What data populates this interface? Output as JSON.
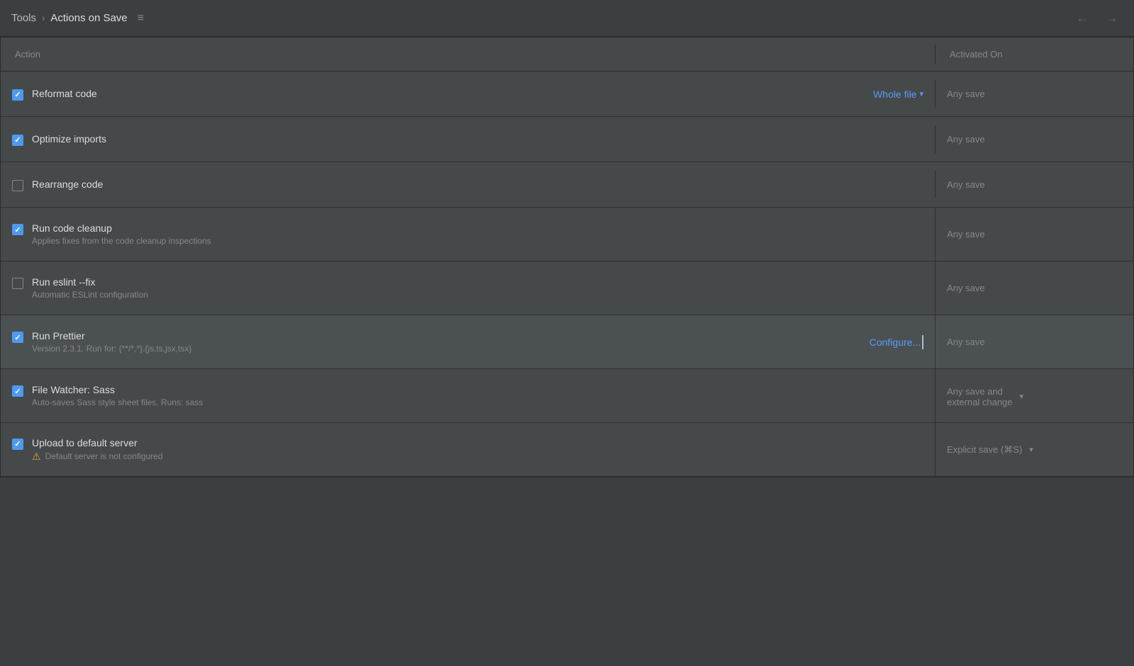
{
  "titlebar": {
    "tools_label": "Tools",
    "chevron": "›",
    "current_page": "Actions on Save",
    "page_icon": "≡",
    "nav_back": "←",
    "nav_forward": "→"
  },
  "table": {
    "col_action": "Action",
    "col_activated": "Activated On",
    "rows": [
      {
        "id": "reformat-code",
        "checked": true,
        "name": "Reformat code",
        "description": "",
        "has_dropdown": true,
        "dropdown_label": "Whole file",
        "activated_on": "Any save",
        "has_activated_dropdown": false,
        "selected": false
      },
      {
        "id": "optimize-imports",
        "checked": true,
        "name": "Optimize imports",
        "description": "",
        "has_dropdown": false,
        "dropdown_label": "",
        "activated_on": "Any save",
        "has_activated_dropdown": false,
        "selected": false
      },
      {
        "id": "rearrange-code",
        "checked": false,
        "name": "Rearrange code",
        "description": "",
        "has_dropdown": false,
        "dropdown_label": "",
        "activated_on": "Any save",
        "has_activated_dropdown": false,
        "selected": false
      },
      {
        "id": "run-code-cleanup",
        "checked": true,
        "name": "Run code cleanup",
        "description": "Applies fixes from the code cleanup inspections",
        "has_dropdown": false,
        "dropdown_label": "",
        "activated_on": "Any save",
        "has_activated_dropdown": false,
        "selected": false
      },
      {
        "id": "run-eslint-fix",
        "checked": false,
        "name": "Run eslint --fix",
        "description": "Automatic ESLint configuration",
        "has_dropdown": false,
        "dropdown_label": "",
        "activated_on": "Any save",
        "has_activated_dropdown": false,
        "selected": false
      },
      {
        "id": "run-prettier",
        "checked": true,
        "name": "Run Prettier",
        "description": "Version 2.3.1. Run for: {**/*,*}.{js,ts,jsx,tsx}",
        "has_dropdown": false,
        "dropdown_label": "",
        "has_configure": true,
        "configure_label": "Configure...",
        "activated_on": "Any save",
        "has_activated_dropdown": false,
        "selected": true
      },
      {
        "id": "file-watcher-sass",
        "checked": true,
        "name": "File Watcher: Sass",
        "description": "Auto-saves Sass style sheet files. Runs: sass",
        "has_dropdown": false,
        "dropdown_label": "",
        "activated_on": "Any save and\nexternal change",
        "has_activated_dropdown": true,
        "selected": false
      },
      {
        "id": "upload-to-server",
        "checked": true,
        "name": "Upload to default server",
        "description": "",
        "has_warning": true,
        "warning_text": "Default server is not configured",
        "has_dropdown": false,
        "dropdown_label": "",
        "activated_on": "Explicit save (⌘S)",
        "has_activated_dropdown": true,
        "selected": false
      }
    ]
  },
  "colors": {
    "accent": "#589df6",
    "bg_dark": "#3c3f41",
    "bg_panel": "#45494a",
    "bg_selected": "#4b5052",
    "text_primary": "#dddddd",
    "text_secondary": "#888888",
    "border": "#2b2b2b",
    "checkbox_checked": "#4e9af1",
    "warning": "#e5a234"
  }
}
